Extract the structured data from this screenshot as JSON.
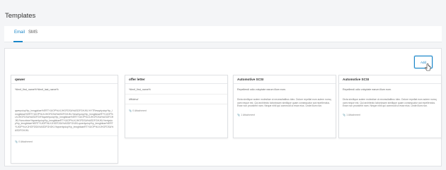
{
  "page": {
    "title": "Templates"
  },
  "tabs": [
    {
      "label": "Email",
      "active": true
    },
    {
      "label": "SMS",
      "active": false
    }
  ],
  "add_button": {
    "label": "Add"
  },
  "colors": {
    "accent": "#1a86c8",
    "background": "#f4f5f7"
  },
  "cards": [
    {
      "title": "qwwer",
      "line1": "%lenf_first_name%%lenf_last_name%",
      "body": "qwerpoiuy%p_lmngpkiae%ERTYUIOP%LKJHGFDSA%ASDFGHJKL%YTRewqrtyuiop%p_lmngbkiae%ERTYUIOP%LKJHGFDSA%ASDFGHJKL%ewrtyuiop%p_lmngbkiaeRTYUIOP%LKJHGFDSA%ASDFGH%qwertyuiop%p_lmngbkiae%ERTYUIOP%LKJHGFDSA%ASDFGHJKL%zxcvbnm%qwertyuiop%p_lmngbkiaeRTYUIOP%LKJHGFDSA%ASDFGHJKL%ertyuiop%p_lmngbkiae%ERTYUIOP%LKJHGFDSA%ASDFGHJKLqwertyuiop%p_lmngbkiae%ERTYUIOP%LKJHGFDSA%ASDFGHJKL%qwertyuiop%p_lmngbkiaeRTYUIOP%LKJHGFDSA%ASDFGHJKL",
      "attachment": "0 Attachment"
    },
    {
      "title": "offer letter",
      "line1": "%lenf_first_name%",
      "line2": "üffklzhuf",
      "attachment": "0 Attachment"
    },
    {
      "title": "Automotive SCSI",
      "line1": "Repellendi odio voluptate earum illum eum.",
      "body": "Dicta similique autem molestiae ut necessitatibus ideo. Dolore repellat eum autem numquam neque est. Qui architecto laboriosam similique quam consequatur aut repellendus. Esse non provident nam. Neque nihil qui commodi ut esse eius. Unde illum non.",
      "attachment": "1 Attachment"
    },
    {
      "title": "Automotive SCSI",
      "line1": "Repellendi odio voluptate earum illum eum.",
      "body": "Dicta similique autem molestiae ut necessitatibus ideo. Dolore repellat eum autem numquam neque est. Qui architecto laboriosam similique quam consequatur aut repellendus. Esse non provident nam. Neque nihil qui commodi ut esse eius. Unde illum non.",
      "attachment": "1 Attachment"
    }
  ]
}
